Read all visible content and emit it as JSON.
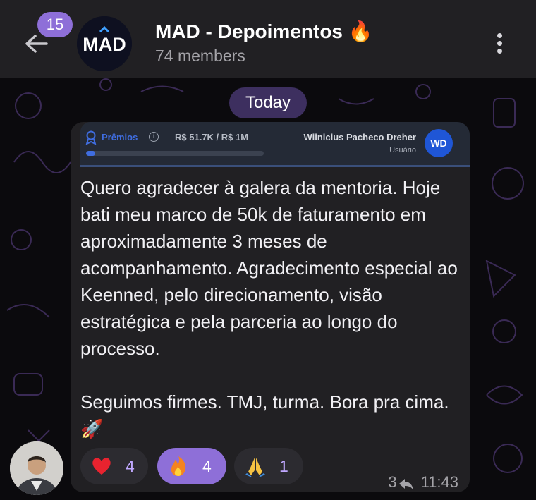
{
  "header": {
    "unread_count": "15",
    "group_title": "MAD - Depoimentos 🔥",
    "group_avatar_text": "MAD",
    "members": "74 members"
  },
  "date_chip": "Today",
  "preview": {
    "prize_label": "Prêmios",
    "prize_values": "R$ 51.7K / R$ 1M",
    "progress_fraction": 0.0517,
    "user_name": "Wiinicius Pacheco Dreher",
    "user_role": "Usuário",
    "user_initials": "WD"
  },
  "message": {
    "paragraph1": "Quero agradecer à galera da mentoria. Hoje bati meu marco de 50k de faturamento em aproximadamente 3 meses de acompanhamento. Agradecimento especial ao Keenned, pelo direcionamento, visão estratégica e pela parceria ao longo do processo.",
    "paragraph2": "Seguimos firmes. TMJ, turma. Bora pra cima. 🚀"
  },
  "reactions": [
    {
      "emoji": "heart",
      "count": "4",
      "active": false
    },
    {
      "emoji": "fire",
      "count": "4",
      "active": true
    },
    {
      "emoji": "folded-hands",
      "count": "1",
      "active": false
    }
  ],
  "meta": {
    "reply_count": "3",
    "time": "11:43"
  },
  "colors": {
    "accent": "#8e6fd8",
    "header_bg": "#212023",
    "bubble_bg": "#212023",
    "date_chip_bg": "#3d2f5f",
    "preview_blue": "#3f6de0"
  }
}
